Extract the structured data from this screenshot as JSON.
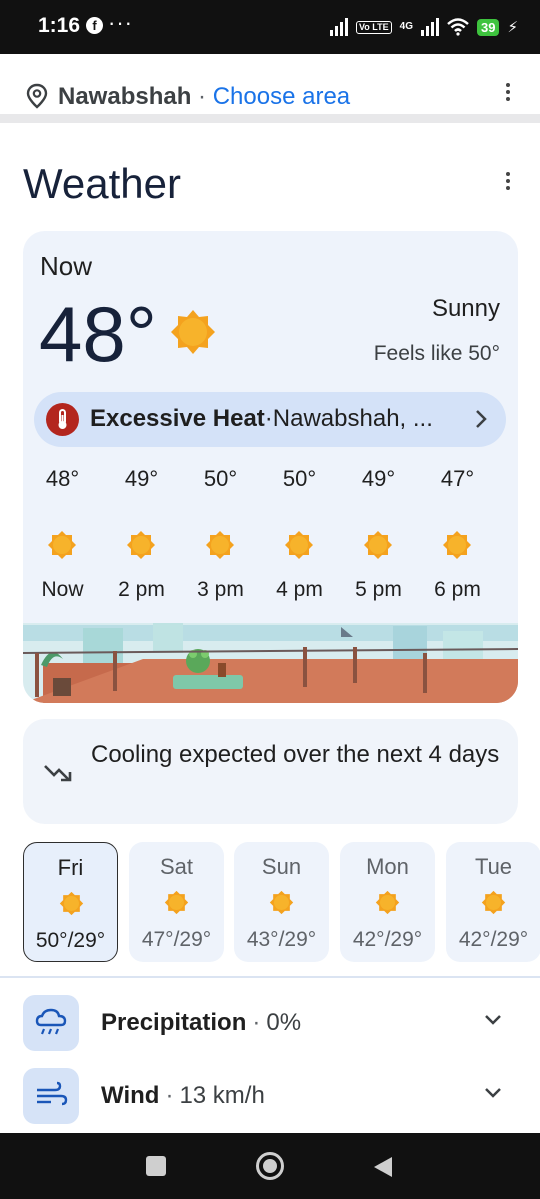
{
  "status": {
    "time": "1:16",
    "app_icon": "facebook-icon",
    "more": "···",
    "volte": "Vo LTE",
    "network": "4G",
    "battery": "39"
  },
  "location": {
    "city": "Nawabshah",
    "separator": "·",
    "choose": "Choose area"
  },
  "weather": {
    "title": "Weather",
    "now_label": "Now",
    "temp": "48°",
    "condition": "Sunny",
    "feels_like": "Feels like 50°",
    "alert": {
      "title": "Excessive Heat",
      "separator": "·",
      "location": "Nawabshah, ..."
    },
    "hourly": [
      {
        "temp": "48°",
        "label": "Now"
      },
      {
        "temp": "49°",
        "label": "2 pm"
      },
      {
        "temp": "50°",
        "label": "3 pm"
      },
      {
        "temp": "50°",
        "label": "4 pm"
      },
      {
        "temp": "49°",
        "label": "5 pm"
      },
      {
        "temp": "47°",
        "label": "6 pm"
      }
    ],
    "trend": "Cooling expected over the next 4 days",
    "daily": [
      {
        "day": "Fri",
        "temps": "50°/29°",
        "selected": true
      },
      {
        "day": "Sat",
        "temps": "47°/29°"
      },
      {
        "day": "Sun",
        "temps": "43°/29°"
      },
      {
        "day": "Mon",
        "temps": "42°/29°"
      },
      {
        "day": "Tue",
        "temps": "42°/29°"
      }
    ],
    "details": [
      {
        "label": "Precipitation",
        "value": "0%",
        "icon": "rain-cloud-icon"
      },
      {
        "label": "Wind",
        "value": "13 km/h",
        "icon": "wind-icon"
      }
    ]
  },
  "colors": {
    "accent": "#1a73e8",
    "sun": "#f6a81e",
    "alert": "#b3261e",
    "card": "#eef3fb"
  }
}
